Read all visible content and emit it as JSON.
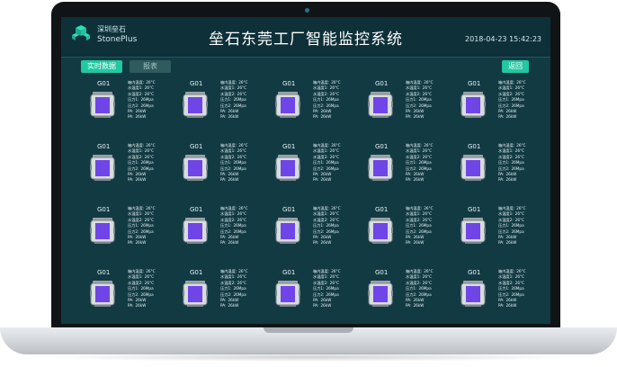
{
  "header": {
    "brand_cn": "深圳垒石",
    "brand_en": "StonePlus",
    "title": "垒石东莞工厂智能监控系统",
    "datetime": "2018-04-23  15:42:23"
  },
  "toolbar": {
    "realtime_label": "实时数据",
    "report_label": "报表",
    "back_label": "返回"
  },
  "icons": {
    "logo": "cube-stack-icon",
    "tank": "tank-icon"
  },
  "colors": {
    "screen_bg": "#123a43",
    "accent": "#21c8a2",
    "tank_fill": "#6f45e8"
  },
  "devices": [
    {
      "name": "G01",
      "params": [
        [
          "箱内温度",
          "26°C"
        ],
        [
          "水温度1",
          "26°C"
        ],
        [
          "水温度2",
          "26°C"
        ],
        [
          "压力1",
          "26Mpa"
        ],
        [
          "压力2",
          "26Mpa"
        ],
        [
          "PA",
          "26kW"
        ],
        [
          "PA",
          "26kW"
        ]
      ]
    },
    {
      "name": "G01",
      "params": [
        [
          "箱内温度",
          "26°C"
        ],
        [
          "水温度1",
          "26°C"
        ],
        [
          "水温度2",
          "26°C"
        ],
        [
          "压力1",
          "26Mpa"
        ],
        [
          "压力2",
          "26Mpa"
        ],
        [
          "PA",
          "26kW"
        ],
        [
          "PA",
          "26kW"
        ]
      ]
    },
    {
      "name": "G01",
      "params": [
        [
          "箱内温度",
          "26°C"
        ],
        [
          "水温度1",
          "26°C"
        ],
        [
          "水温度2",
          "26°C"
        ],
        [
          "压力1",
          "26Mpa"
        ],
        [
          "压力2",
          "26Mpa"
        ],
        [
          "PA",
          "26kW"
        ],
        [
          "PA",
          "26kW"
        ]
      ]
    },
    {
      "name": "G01",
      "params": [
        [
          "箱内温度",
          "26°C"
        ],
        [
          "水温度1",
          "26°C"
        ],
        [
          "水温度2",
          "26°C"
        ],
        [
          "压力1",
          "26Mpa"
        ],
        [
          "压力2",
          "26Mpa"
        ],
        [
          "PA",
          "26kW"
        ],
        [
          "PA",
          "26kW"
        ]
      ]
    },
    {
      "name": "G01",
      "params": [
        [
          "箱内温度",
          "26°C"
        ],
        [
          "水温度1",
          "26°C"
        ],
        [
          "水温度2",
          "26°C"
        ],
        [
          "压力1",
          "26Mpa"
        ],
        [
          "压力2",
          "26Mpa"
        ],
        [
          "PA",
          "26kW"
        ],
        [
          "PA",
          "26kW"
        ]
      ]
    },
    {
      "name": "G01",
      "params": [
        [
          "箱内温度",
          "26°C"
        ],
        [
          "水温度1",
          "26°C"
        ],
        [
          "水温度2",
          "26°C"
        ],
        [
          "压力1",
          "26Mpa"
        ],
        [
          "压力2",
          "26Mpa"
        ],
        [
          "PA",
          "26kW"
        ],
        [
          "PA",
          "26kW"
        ]
      ]
    },
    {
      "name": "G01",
      "params": [
        [
          "箱内温度",
          "26°C"
        ],
        [
          "水温度1",
          "26°C"
        ],
        [
          "水温度2",
          "26°C"
        ],
        [
          "压力1",
          "26Mpa"
        ],
        [
          "压力2",
          "26Mpa"
        ],
        [
          "PA",
          "26kW"
        ],
        [
          "PA",
          "26kW"
        ]
      ]
    },
    {
      "name": "G01",
      "params": [
        [
          "箱内温度",
          "26°C"
        ],
        [
          "水温度1",
          "26°C"
        ],
        [
          "水温度2",
          "26°C"
        ],
        [
          "压力1",
          "26Mpa"
        ],
        [
          "压力2",
          "26Mpa"
        ],
        [
          "PA",
          "26kW"
        ],
        [
          "PA",
          "26kW"
        ]
      ]
    },
    {
      "name": "G01",
      "params": [
        [
          "箱内温度",
          "26°C"
        ],
        [
          "水温度1",
          "26°C"
        ],
        [
          "水温度2",
          "26°C"
        ],
        [
          "压力1",
          "26Mpa"
        ],
        [
          "压力2",
          "26Mpa"
        ],
        [
          "PA",
          "26kW"
        ],
        [
          "PA",
          "26kW"
        ]
      ]
    },
    {
      "name": "G01",
      "params": [
        [
          "箱内温度",
          "26°C"
        ],
        [
          "水温度1",
          "26°C"
        ],
        [
          "水温度2",
          "26°C"
        ],
        [
          "压力1",
          "26Mpa"
        ],
        [
          "压力2",
          "26Mpa"
        ],
        [
          "PA",
          "26kW"
        ],
        [
          "PA",
          "26kW"
        ]
      ]
    },
    {
      "name": "G01",
      "params": [
        [
          "箱内温度",
          "26°C"
        ],
        [
          "水温度1",
          "26°C"
        ],
        [
          "水温度2",
          "26°C"
        ],
        [
          "压力1",
          "26Mpa"
        ],
        [
          "压力2",
          "26Mpa"
        ],
        [
          "PA",
          "26kW"
        ],
        [
          "PA",
          "26kW"
        ]
      ]
    },
    {
      "name": "G01",
      "params": [
        [
          "箱内温度",
          "26°C"
        ],
        [
          "水温度1",
          "26°C"
        ],
        [
          "水温度2",
          "26°C"
        ],
        [
          "压力1",
          "26Mpa"
        ],
        [
          "压力2",
          "26Mpa"
        ],
        [
          "PA",
          "26kW"
        ],
        [
          "PA",
          "26kW"
        ]
      ]
    },
    {
      "name": "G01",
      "params": [
        [
          "箱内温度",
          "26°C"
        ],
        [
          "水温度1",
          "26°C"
        ],
        [
          "水温度2",
          "26°C"
        ],
        [
          "压力1",
          "26Mpa"
        ],
        [
          "压力2",
          "26Mpa"
        ],
        [
          "PA",
          "26kW"
        ],
        [
          "PA",
          "26kW"
        ]
      ]
    },
    {
      "name": "G01",
      "params": [
        [
          "箱内温度",
          "26°C"
        ],
        [
          "水温度1",
          "26°C"
        ],
        [
          "水温度2",
          "26°C"
        ],
        [
          "压力1",
          "26Mpa"
        ],
        [
          "压力2",
          "26Mpa"
        ],
        [
          "PA",
          "26kW"
        ],
        [
          "PA",
          "26kW"
        ]
      ]
    },
    {
      "name": "G01",
      "params": [
        [
          "箱内温度",
          "26°C"
        ],
        [
          "水温度1",
          "26°C"
        ],
        [
          "水温度2",
          "26°C"
        ],
        [
          "压力1",
          "26Mpa"
        ],
        [
          "压力2",
          "26Mpa"
        ],
        [
          "PA",
          "26kW"
        ],
        [
          "PA",
          "26kW"
        ]
      ]
    },
    {
      "name": "G01",
      "params": [
        [
          "箱内温度",
          "26°C"
        ],
        [
          "水温度1",
          "26°C"
        ],
        [
          "水温度2",
          "26°C"
        ],
        [
          "压力1",
          "26Mpa"
        ],
        [
          "压力2",
          "26Mpa"
        ],
        [
          "PA",
          "26kW"
        ],
        [
          "PA",
          "26kW"
        ]
      ]
    },
    {
      "name": "G01",
      "params": [
        [
          "箱内温度",
          "26°C"
        ],
        [
          "水温度1",
          "26°C"
        ],
        [
          "水温度2",
          "26°C"
        ],
        [
          "压力1",
          "26Mpa"
        ],
        [
          "压力2",
          "26Mpa"
        ],
        [
          "PA",
          "26kW"
        ],
        [
          "PA",
          "26kW"
        ]
      ]
    },
    {
      "name": "G01",
      "params": [
        [
          "箱内温度",
          "26°C"
        ],
        [
          "水温度1",
          "26°C"
        ],
        [
          "水温度2",
          "26°C"
        ],
        [
          "压力1",
          "26Mpa"
        ],
        [
          "压力2",
          "26Mpa"
        ],
        [
          "PA",
          "26kW"
        ],
        [
          "PA",
          "26kW"
        ]
      ]
    },
    {
      "name": "G01",
      "params": [
        [
          "箱内温度",
          "26°C"
        ],
        [
          "水温度1",
          "26°C"
        ],
        [
          "水温度2",
          "26°C"
        ],
        [
          "压力1",
          "26Mpa"
        ],
        [
          "压力2",
          "26Mpa"
        ],
        [
          "PA",
          "26kW"
        ],
        [
          "PA",
          "26kW"
        ]
      ]
    },
    {
      "name": "G01",
      "params": [
        [
          "箱内温度",
          "26°C"
        ],
        [
          "水温度1",
          "26°C"
        ],
        [
          "水温度2",
          "26°C"
        ],
        [
          "压力1",
          "26Mpa"
        ],
        [
          "压力2",
          "26Mpa"
        ],
        [
          "PA",
          "26kW"
        ],
        [
          "PA",
          "26kW"
        ]
      ]
    }
  ]
}
